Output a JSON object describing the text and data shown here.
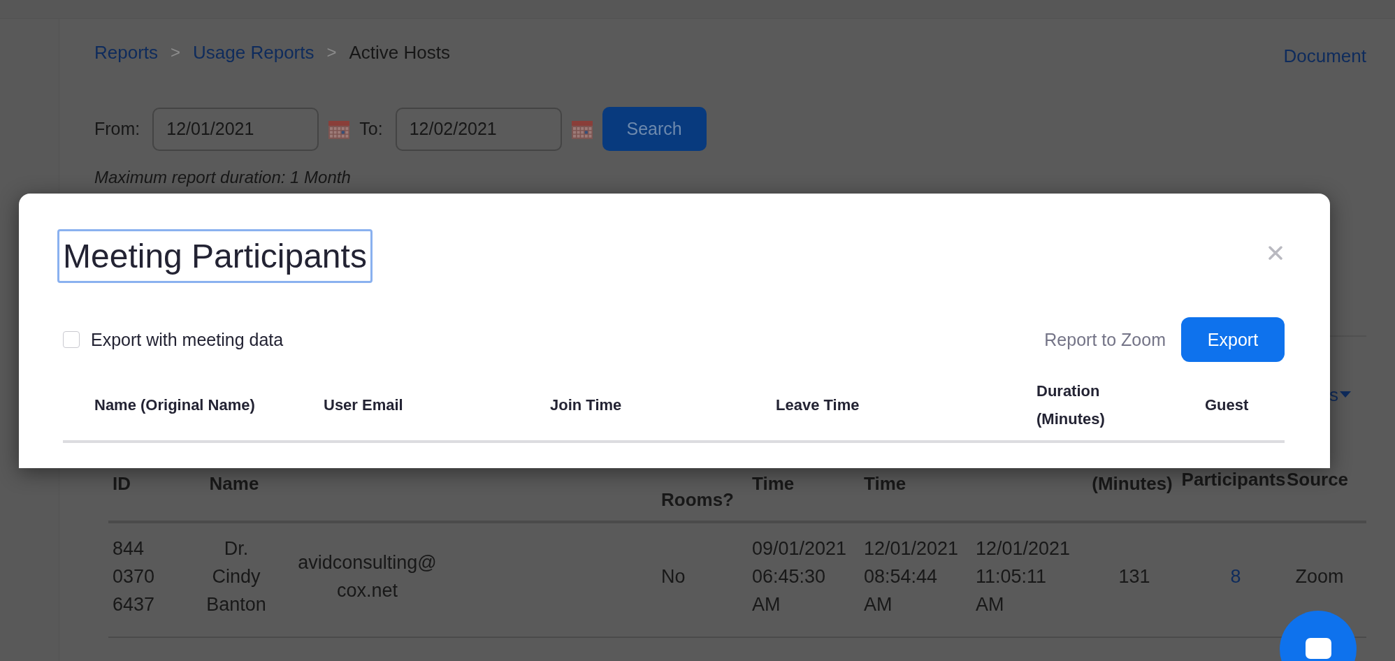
{
  "breadcrumb": [
    {
      "kind": "link",
      "label": "Reports"
    },
    {
      "kind": "separator",
      "label": ">"
    },
    {
      "kind": "link",
      "label": "Usage Reports"
    },
    {
      "kind": "separator",
      "label": ">"
    },
    {
      "kind": "current",
      "label": "Active Hosts"
    }
  ],
  "document_link": "Document",
  "date_filter": {
    "from_label": "From:",
    "from_value": "12/01/2021",
    "to_label": "To:",
    "to_value": "12/02/2021",
    "search_button": "Search",
    "note": "Maximum report duration: 1 Month"
  },
  "hosts_table": {
    "menu_fragment": "s",
    "columns": [
      {
        "label": "ID"
      },
      {
        "label": "Name"
      },
      {},
      {},
      {},
      {
        "label": "Rooms?"
      },
      {
        "label": "Time"
      },
      {
        "label": "Time"
      },
      {},
      {
        "label": "(Minutes)"
      },
      {
        "label": "Participants"
      },
      {
        "label": "Source"
      }
    ],
    "rows": [
      {
        "cells": [
          {
            "kind": "text",
            "text": "844 0370 6437"
          },
          {
            "kind": "text",
            "text": "Dr. Cindy Banton"
          },
          {
            "kind": "text",
            "text": "avidconsulting@cox.net"
          },
          {},
          {},
          {
            "kind": "text",
            "text": "No"
          },
          {
            "kind": "text",
            "text": "09/01/2021 06:45:30 AM"
          },
          {
            "kind": "text",
            "text": "12/01/2021 08:54:44 AM"
          },
          {
            "kind": "text",
            "text": "12/01/2021 11:05:11 AM"
          },
          {
            "kind": "text",
            "text": "131"
          },
          {
            "kind": "link",
            "text": "8"
          },
          {
            "kind": "text",
            "text": "Zoom"
          }
        ]
      }
    ]
  },
  "modal": {
    "title": "Meeting Participants",
    "export_checkbox": {
      "label": "Export with meeting data",
      "checked": false
    },
    "report_link": "Report to Zoom",
    "export_button": "Export",
    "columns": [
      {
        "label": "Name (Original Name)"
      },
      {
        "label": "User Email"
      },
      {
        "label": "Join Time"
      },
      {
        "label": "Leave Time"
      },
      {
        "label": "Duration (Minutes)"
      },
      {
        "label": "Guest"
      }
    ]
  }
}
